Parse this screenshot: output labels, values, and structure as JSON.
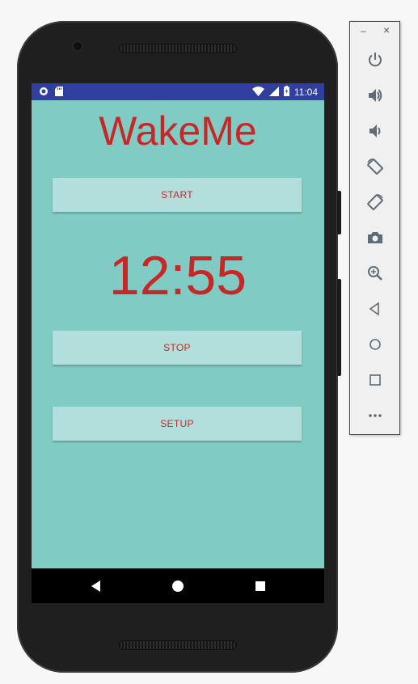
{
  "app": {
    "title": "WakeMe",
    "timer": "12:55",
    "buttons": {
      "start": "START",
      "stop": "STOP",
      "setup": "SETUP"
    }
  },
  "statusbar": {
    "time": "11:04",
    "icons": [
      "circle-notification-icon",
      "sd-card-icon",
      "wifi-icon",
      "cell-signal-icon",
      "battery-icon"
    ]
  },
  "navbar": {
    "icons": [
      "back-icon",
      "home-icon",
      "recents-icon"
    ]
  },
  "emulator_panel": {
    "window_controls": [
      "minimize-icon",
      "close-icon"
    ],
    "minimize_label": "–",
    "close_label": "×",
    "buttons": [
      "power-icon",
      "volume-up-icon",
      "volume-down-icon",
      "rotate-left-icon",
      "rotate-right-icon",
      "screenshot-icon",
      "zoom-icon",
      "back-icon",
      "home-icon",
      "overview-icon",
      "more-icon"
    ]
  },
  "colors": {
    "statusbar": "#303f9f",
    "background": "#80cbc4",
    "button": "#b2dfdb",
    "accent_text": "#c62828"
  }
}
